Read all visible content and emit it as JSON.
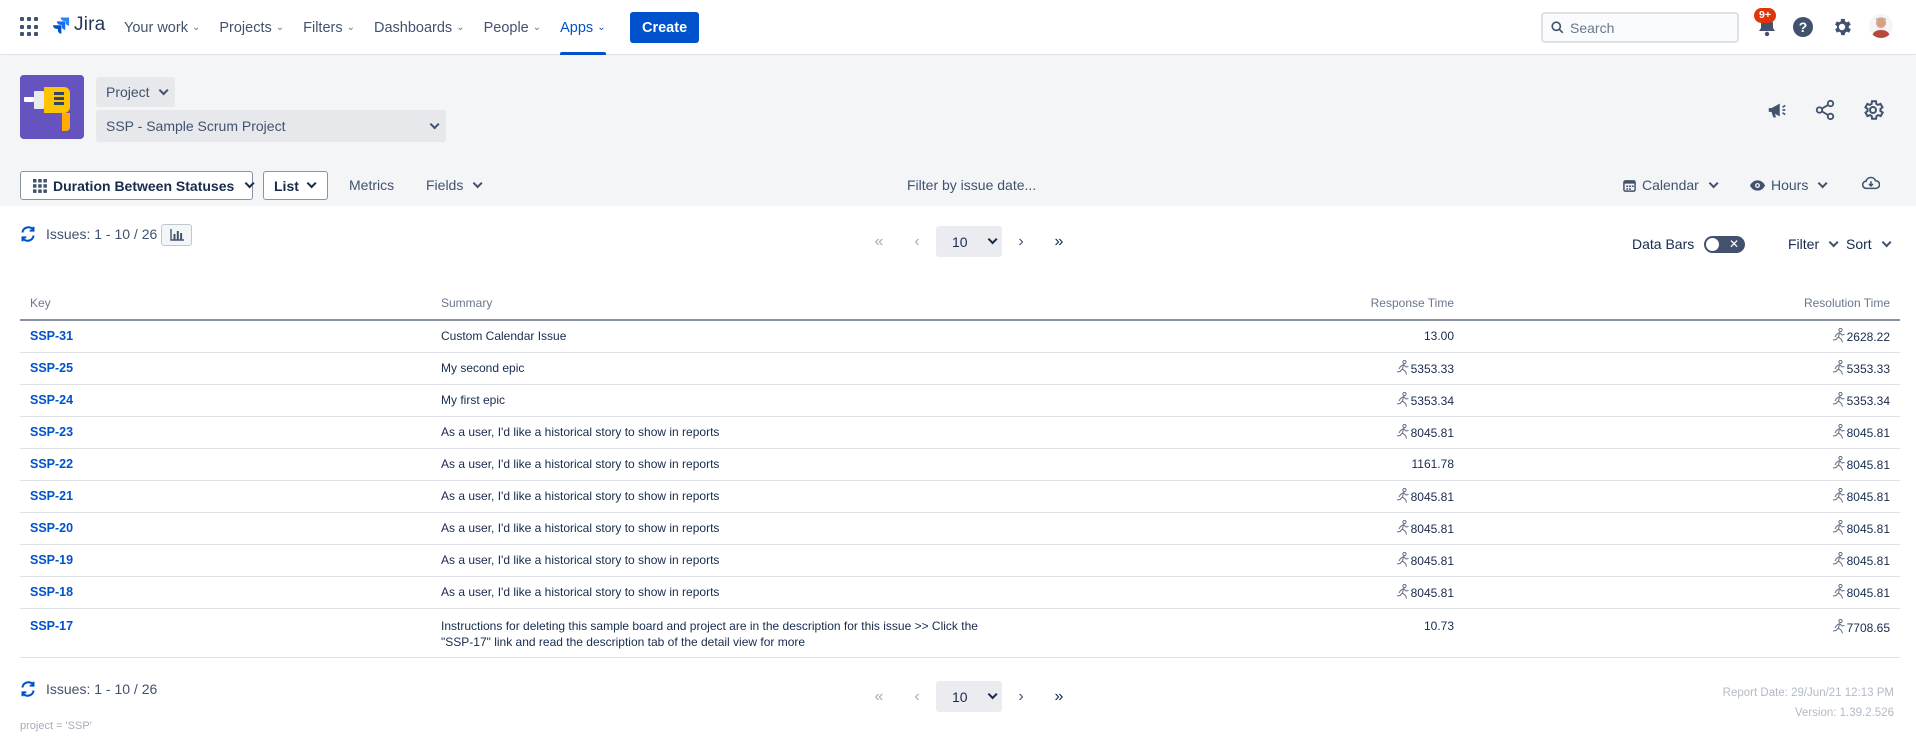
{
  "nav": {
    "logo_text": "Jira",
    "links": [
      {
        "label": "Your work",
        "active": false
      },
      {
        "label": "Projects",
        "active": false
      },
      {
        "label": "Filters",
        "active": false
      },
      {
        "label": "Dashboards",
        "active": false
      },
      {
        "label": "People",
        "active": false
      },
      {
        "label": "Apps",
        "active": true
      }
    ],
    "create_label": "Create",
    "search_placeholder": "Search",
    "notification_badge": "9+",
    "icons": [
      "app-switcher-icon",
      "jira-logo-icon",
      "search-icon",
      "notification-bell-icon",
      "help-icon",
      "settings-icon",
      "avatar"
    ]
  },
  "project": {
    "type_selector": "Project",
    "selected_project": "SSP - Sample Scrum Project",
    "header_icons": [
      "announcement-icon",
      "share-icon",
      "settings-icon"
    ]
  },
  "toolbar": {
    "report_type": "Duration Between Statuses",
    "view": "List",
    "metrics": "Metrics",
    "fields": "Fields",
    "date_filter": "Filter by issue date...",
    "calendar": "Calendar",
    "time_unit": "Hours"
  },
  "results": {
    "count_text": "Issues: 1 - 10 / 26",
    "page_size": "10",
    "data_bars_label": "Data Bars",
    "data_bars_on": false,
    "filter_label": "Filter",
    "sort_label": "Sort",
    "columns": {
      "key": "Key",
      "summary": "Summary",
      "response": "Response Time",
      "resolution": "Resolution Time"
    },
    "rows": [
      {
        "key": "SSP-31",
        "summary": "Custom Calendar Issue",
        "response": "13.00",
        "response_icon": false,
        "resolution": "2628.22",
        "resolution_icon": true
      },
      {
        "key": "SSP-25",
        "summary": "My second epic",
        "response": "5353.33",
        "response_icon": true,
        "resolution": "5353.33",
        "resolution_icon": true
      },
      {
        "key": "SSP-24",
        "summary": "My first epic",
        "response": "5353.34",
        "response_icon": true,
        "resolution": "5353.34",
        "resolution_icon": true
      },
      {
        "key": "SSP-23",
        "summary": "As a user, I'd like a historical story to show in reports",
        "response": "8045.81",
        "response_icon": true,
        "resolution": "8045.81",
        "resolution_icon": true
      },
      {
        "key": "SSP-22",
        "summary": "As a user, I'd like a historical story to show in reports",
        "response": "1161.78",
        "response_icon": false,
        "resolution": "8045.81",
        "resolution_icon": true
      },
      {
        "key": "SSP-21",
        "summary": "As a user, I'd like a historical story to show in reports",
        "response": "8045.81",
        "response_icon": true,
        "resolution": "8045.81",
        "resolution_icon": true
      },
      {
        "key": "SSP-20",
        "summary": "As a user, I'd like a historical story to show in reports",
        "response": "8045.81",
        "response_icon": true,
        "resolution": "8045.81",
        "resolution_icon": true
      },
      {
        "key": "SSP-19",
        "summary": "As a user, I'd like a historical story to show in reports",
        "response": "8045.81",
        "response_icon": true,
        "resolution": "8045.81",
        "resolution_icon": true
      },
      {
        "key": "SSP-18",
        "summary": "As a user, I'd like a historical story to show in reports",
        "response": "8045.81",
        "response_icon": true,
        "resolution": "8045.81",
        "resolution_icon": true
      },
      {
        "key": "SSP-17",
        "summary_lines": [
          "Instructions for deleting this sample board and project are in the description for this issue >> Click the",
          "\"SSP-17\" link and read the description tab of the detail view for more"
        ],
        "response": "10.73",
        "response_icon": false,
        "resolution": "7708.65",
        "resolution_icon": true
      }
    ]
  },
  "footer": {
    "report_date": "Report Date: 29/Jun/21 12:13 PM",
    "version": "Version: 1.39.2.526",
    "jql": "project = 'SSP'"
  },
  "colors": {
    "brand": "#0052cc",
    "badge": "#de350b",
    "project_logo_bg": "#6554c0",
    "header_bg": "#f4f5f7"
  }
}
